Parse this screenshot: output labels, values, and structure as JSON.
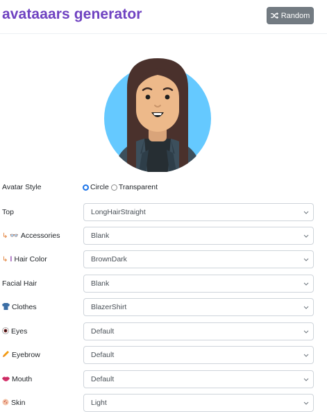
{
  "header": {
    "title": "avataaars generator",
    "random_label": "Random"
  },
  "avatar_style": {
    "label": "Avatar Style",
    "options": [
      "Circle",
      "Transparent"
    ],
    "selected": "Circle"
  },
  "fields": [
    {
      "label": "Top",
      "value": "LongHairStraight",
      "icon": ""
    },
    {
      "label": "Accessories",
      "value": "Blank",
      "icon": "sunglasses-icon"
    },
    {
      "label": "Hair Color",
      "value": "BrownDark",
      "icon": "paintbrush-icon"
    },
    {
      "label": "Facial Hair",
      "value": "Blank",
      "icon": ""
    },
    {
      "label": "Clothes",
      "value": "BlazerShirt",
      "icon": "shirt-icon"
    },
    {
      "label": "Eyes",
      "value": "Default",
      "icon": "eye-icon"
    },
    {
      "label": "Eyebrow",
      "value": "Default",
      "icon": "pencil-icon"
    },
    {
      "label": "Mouth",
      "value": "Default",
      "icon": "lips-icon"
    },
    {
      "label": "Skin",
      "value": "Light",
      "icon": "skin-icon"
    }
  ],
  "colors": {
    "title": "#6f42c1",
    "button": "#737b82",
    "avatar_background": "#65c9ff",
    "hair": "#4a312c",
    "skin": "#edb98a",
    "blazer": "#3c4f5c"
  }
}
